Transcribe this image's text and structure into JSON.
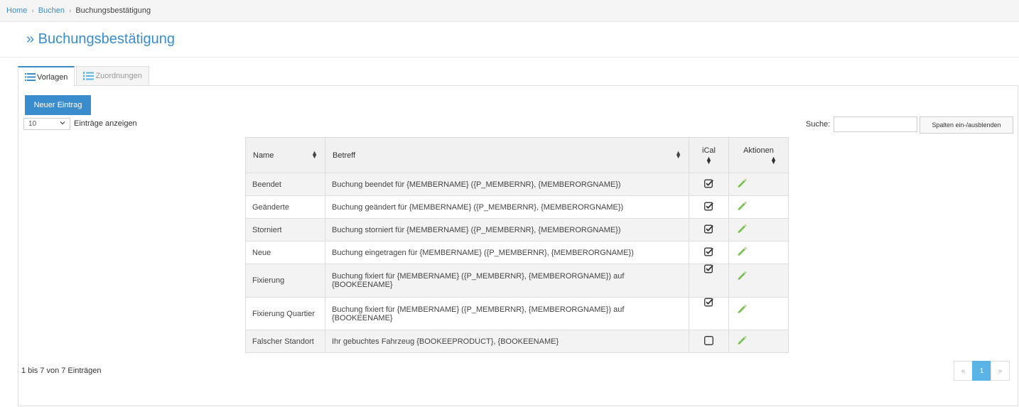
{
  "breadcrumb": {
    "home": "Home",
    "buchen": "Buchen",
    "current": "Buchungsbestätigung"
  },
  "page": {
    "title": "» Buchungsbestätigung"
  },
  "tabs": [
    {
      "label": "Vorlagen",
      "active": true
    },
    {
      "label": "Zuordnungen",
      "active": false
    }
  ],
  "toolbar": {
    "new_label": "Neuer Eintrag",
    "length_value": "10",
    "length_label": "Einträge anzeigen",
    "search_label": "Suche:",
    "search_value": "",
    "colvis_label": "Spalten ein-/ausblenden"
  },
  "table": {
    "headers": {
      "name": "Name",
      "betreff": "Betreff",
      "ical": "iCal",
      "aktionen": "Aktionen"
    },
    "rows": [
      {
        "name": "Beendet",
        "betreff": "Buchung beendet für {MEMBERNAME} ({P_MEMBERNR}, {MEMBERORGNAME})",
        "ical": true
      },
      {
        "name": "Geänderte",
        "betreff": "Buchung geändert für {MEMBERNAME} ({P_MEMBERNR}, {MEMBERORGNAME})",
        "ical": true
      },
      {
        "name": "Storniert",
        "betreff": "Buchung storniert für {MEMBERNAME} ({P_MEMBERNR}, {MEMBERORGNAME})",
        "ical": true
      },
      {
        "name": "Neue",
        "betreff": "Buchung eingetragen für {MEMBERNAME} ({P_MEMBERNR}, {MEMBERORGNAME})",
        "ical": true
      },
      {
        "name": "Fixierung",
        "betreff": "Buchung fixiert für {MEMBERNAME} ({P_MEMBERNR}, {MEMBERORGNAME}) auf {BOOKEENAME}",
        "ical": true
      },
      {
        "name": "Fixierung Quartier",
        "betreff": "Buchung fixiert für {MEMBERNAME} ({P_MEMBERNR}, {MEMBERORGNAME}) auf {BOOKEENAME}",
        "ical": true
      },
      {
        "name": "Falscher Standort",
        "betreff": "Ihr gebuchtes Fahrzeug {BOOKEEPRODUCT}, {BOOKEENAME}",
        "ical": false
      }
    ]
  },
  "footer": {
    "info": "1 bis 7 von 7 Einträgen"
  },
  "pagination": {
    "prev": "«",
    "current": "1",
    "next": "»"
  },
  "icons": {
    "list": "list-icon",
    "ordered_list": "ordered-list-icon",
    "edit": "pencil-icon",
    "checked": "checkbox-checked-icon",
    "unchecked": "checkbox-empty-icon"
  },
  "colors": {
    "accent": "#3a8dcc",
    "edit": "#7cc153",
    "page_active": "#5ab4e6"
  }
}
